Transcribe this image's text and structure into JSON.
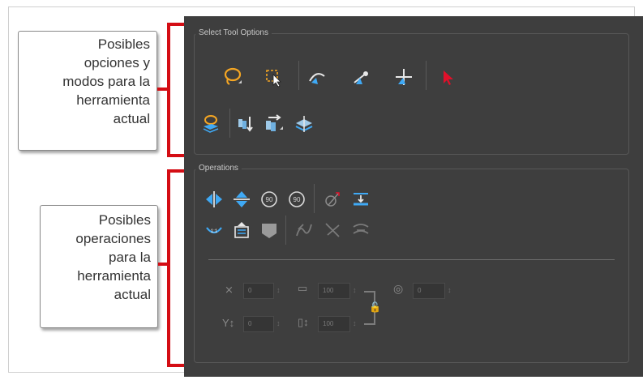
{
  "callouts": {
    "top": [
      "Posibles",
      "opciones y",
      "modos para la",
      "herramienta",
      "actual"
    ],
    "bottom": [
      "Posibles",
      "operaciones",
      "para la",
      "herramienta",
      "actual"
    ]
  },
  "colors": {
    "bracket": "#d40d14",
    "panel_bg": "#3e3e3e",
    "accent_blue": "#3fa9f5",
    "accent_orange": "#f5a623"
  },
  "select_tool_options": {
    "title": "Select Tool Options",
    "row1_icons": [
      "lasso-icon",
      "marquee-icon",
      "snap-contour-icon",
      "snap-point-icon",
      "snap-grid-icon",
      "select-red-arrow-icon"
    ],
    "row2_icons": [
      "select-by-color-icon",
      "apply-to-all-drawings-icon",
      "repaint-selection-icon",
      "morphing-icon"
    ]
  },
  "operations": {
    "title": "Operations",
    "row1_icons": [
      "flip-horizontal-icon",
      "flip-vertical-icon",
      "rotate-90-cw-icon",
      "rotate-90-ccw-icon",
      "create-empty-drawing-icon",
      "distribute-to-layers-icon"
    ],
    "row2_icons": [
      "smooth-icon",
      "flatten-icon",
      "store-drawing-icon",
      "straighten-icon",
      "remove-point-icon",
      "simplify-icon"
    ],
    "fields": {
      "x": "0",
      "y": "0",
      "width": "100",
      "height": "100",
      "angle": "0"
    }
  }
}
